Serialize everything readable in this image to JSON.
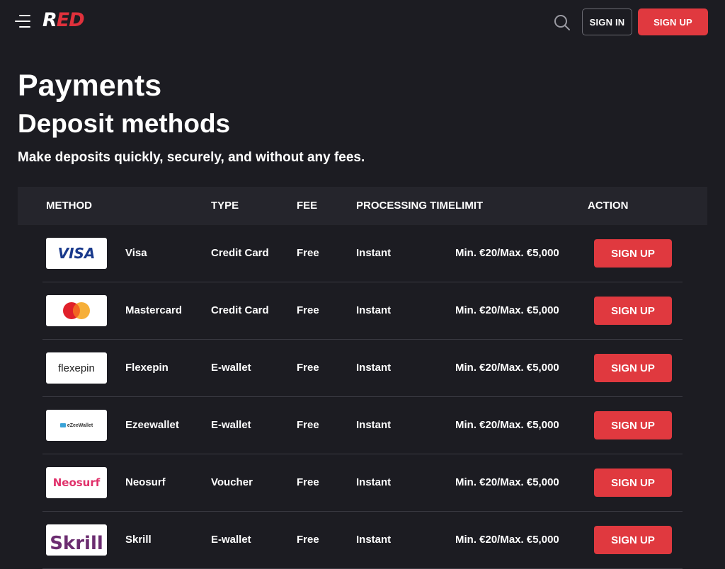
{
  "header": {
    "logo_first": "R",
    "logo_rest": "ED",
    "signin_label": "SIGN IN",
    "signup_label": "SIGN UP",
    "accent_color": "#e0393f"
  },
  "page": {
    "title": "Payments",
    "section_title": "Deposit methods",
    "subtitle": "Make deposits quickly, securely, and without any fees."
  },
  "table": {
    "columns": [
      "METHOD",
      "TYPE",
      "FEE",
      "PROCESSING TIME",
      "LIMIT",
      "ACTION"
    ],
    "rows": [
      {
        "logo_text": "VISA",
        "method": "Visa",
        "type": "Credit Card",
        "fee": "Free",
        "time": "Instant",
        "limit": "Min. €20/Max. €5,000",
        "action": "SIGN UP"
      },
      {
        "logo_text": "",
        "method": "Mastercard",
        "type": "Credit Card",
        "fee": "Free",
        "time": "Instant",
        "limit": "Min. €20/Max. €5,000",
        "action": "SIGN UP"
      },
      {
        "logo_text": "flexepin",
        "method": "Flexepin",
        "type": "E-wallet",
        "fee": "Free",
        "time": "Instant",
        "limit": "Min. €20/Max. €5,000",
        "action": "SIGN UP"
      },
      {
        "logo_text": "eZeeWallet",
        "method": "Ezeewallet",
        "type": "E-wallet",
        "fee": "Free",
        "time": "Instant",
        "limit": "Min. €20/Max. €5,000",
        "action": "SIGN UP"
      },
      {
        "logo_text": "Neosurf",
        "method": "Neosurf",
        "type": "Voucher",
        "fee": "Free",
        "time": "Instant",
        "limit": "Min. €20/Max. €5,000",
        "action": "SIGN UP"
      },
      {
        "logo_text": "Skrill",
        "method": "Skrill",
        "type": "E-wallet",
        "fee": "Free",
        "time": "Instant",
        "limit": "Min. €20/Max. €5,000",
        "action": "SIGN UP"
      }
    ]
  }
}
